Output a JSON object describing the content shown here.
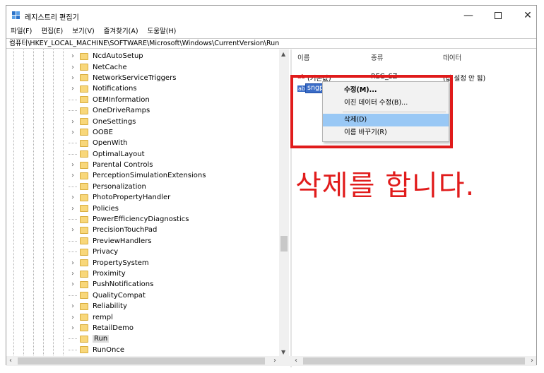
{
  "window": {
    "title": "레지스트리 편집기",
    "minimize": "—",
    "close": "✕"
  },
  "menu": [
    "파일(F)",
    "편집(E)",
    "보기(V)",
    "즐겨찾기(A)",
    "도움말(H)"
  ],
  "address": "컴퓨터\\HKEY_LOCAL_MACHINE\\SOFTWARE\\Microsoft\\Windows\\CurrentVersion\\Run",
  "tree": {
    "items": [
      {
        "label": "NcdAutoSetup",
        "expandable": true
      },
      {
        "label": "NetCache",
        "expandable": true
      },
      {
        "label": "NetworkServiceTriggers",
        "expandable": true
      },
      {
        "label": "Notifications",
        "expandable": true
      },
      {
        "label": "OEMInformation",
        "expandable": false
      },
      {
        "label": "OneDriveRamps",
        "expandable": false
      },
      {
        "label": "OneSettings",
        "expandable": true
      },
      {
        "label": "OOBE",
        "expandable": true
      },
      {
        "label": "OpenWith",
        "expandable": false
      },
      {
        "label": "OptimalLayout",
        "expandable": false
      },
      {
        "label": "Parental Controls",
        "expandable": true
      },
      {
        "label": "PerceptionSimulationExtensions",
        "expandable": true
      },
      {
        "label": "Personalization",
        "expandable": false
      },
      {
        "label": "PhotoPropertyHandler",
        "expandable": true
      },
      {
        "label": "Policies",
        "expandable": true
      },
      {
        "label": "PowerEfficiencyDiagnostics",
        "expandable": false
      },
      {
        "label": "PrecisionTouchPad",
        "expandable": true
      },
      {
        "label": "PreviewHandlers",
        "expandable": false
      },
      {
        "label": "Privacy",
        "expandable": false
      },
      {
        "label": "PropertySystem",
        "expandable": true
      },
      {
        "label": "Proximity",
        "expandable": true
      },
      {
        "label": "PushNotifications",
        "expandable": true
      },
      {
        "label": "QualityCompat",
        "expandable": false
      },
      {
        "label": "Reliability",
        "expandable": true
      },
      {
        "label": "rempl",
        "expandable": true
      },
      {
        "label": "RetailDemo",
        "expandable": true
      },
      {
        "label": "Run",
        "expandable": false,
        "selected": true
      },
      {
        "label": "RunOnce",
        "expandable": false
      }
    ]
  },
  "list": {
    "columns": [
      "이름",
      "종류",
      "데이터"
    ],
    "rows": [
      {
        "icon": "ab",
        "name": "(기본값)",
        "type": "REG_SZ",
        "data": "(값 설정 안 됨)"
      },
      {
        "icon": "ab",
        "name": "sngp",
        "editing": true
      }
    ]
  },
  "context_menu": {
    "items": [
      "수정(M)...",
      "이진 데이터 수정(B)...",
      "삭제(D)",
      "이름 바꾸기(R)"
    ],
    "highlighted_index": 2
  },
  "annotation": "삭제를 합니다.",
  "colors": {
    "highlight_box": "#e01b1b",
    "annotation_text": "#e11c1c",
    "menu_highlight": "#99c8f5",
    "folder": "#f8d77a"
  },
  "icons": {
    "app": "registry-editor-icon",
    "string_value": "reg-sz-icon",
    "folder": "folder-icon"
  }
}
